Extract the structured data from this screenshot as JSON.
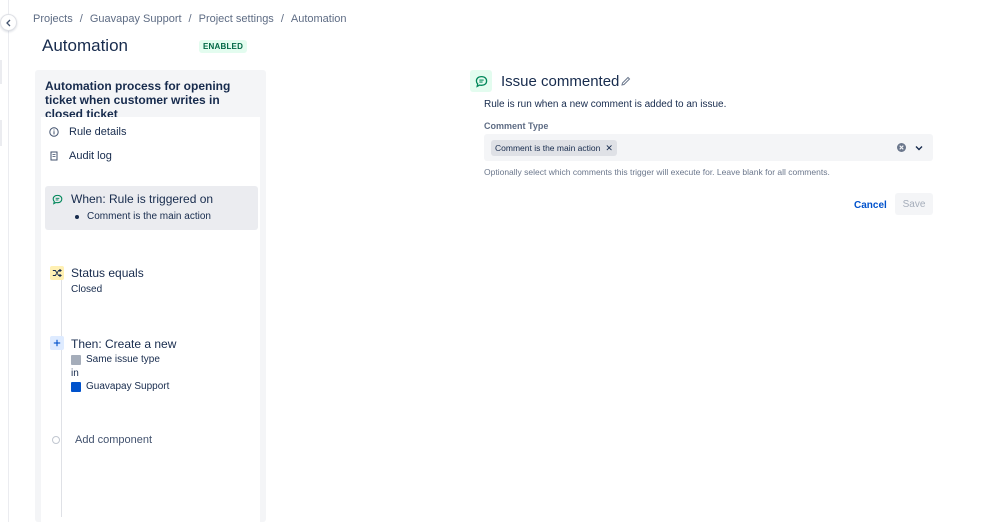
{
  "breadcrumb": [
    "Projects",
    "Guavapay Support",
    "Project settings",
    "Automation"
  ],
  "breadcrumb_separator": "/",
  "page": {
    "title": "Automation",
    "status_badge": "ENABLED"
  },
  "rule": {
    "name": "Automation process for opening ticket when customer writes in closed ticket",
    "menu": [
      {
        "label": "Rule details",
        "icon": "info-icon"
      },
      {
        "label": "Audit log",
        "icon": "document-icon"
      }
    ],
    "trigger": {
      "title": "When: Rule is triggered on",
      "detail": "Comment is the main action",
      "icon": "comment-icon"
    },
    "condition": {
      "title": "Status equals",
      "detail": "Closed",
      "icon": "shuffle-icon"
    },
    "action": {
      "title": "Then: Create a new",
      "issue_type": "Same issue type",
      "in_label": "in",
      "project": "Guavapay Support",
      "icon": "plus-icon"
    },
    "add_component": "Add component"
  },
  "config": {
    "title": "Issue commented",
    "description": "Rule is run when a new comment is added to an issue.",
    "field_label": "Comment Type",
    "selected_value": "Comment is the main action",
    "helper_text": "Optionally select which comments this trigger will execute for. Leave blank for all comments.",
    "cancel_label": "Cancel",
    "save_label": "Save"
  },
  "colors": {
    "text": "#172b4d",
    "link": "#0052cc",
    "badge_bg": "#e3fcef",
    "badge_text": "#006644",
    "panel_bg": "#f4f5f7",
    "trigger_icon": "#00875a",
    "condition_icon_bg": "#fff0b3",
    "action_icon_bg": "#deebff"
  }
}
